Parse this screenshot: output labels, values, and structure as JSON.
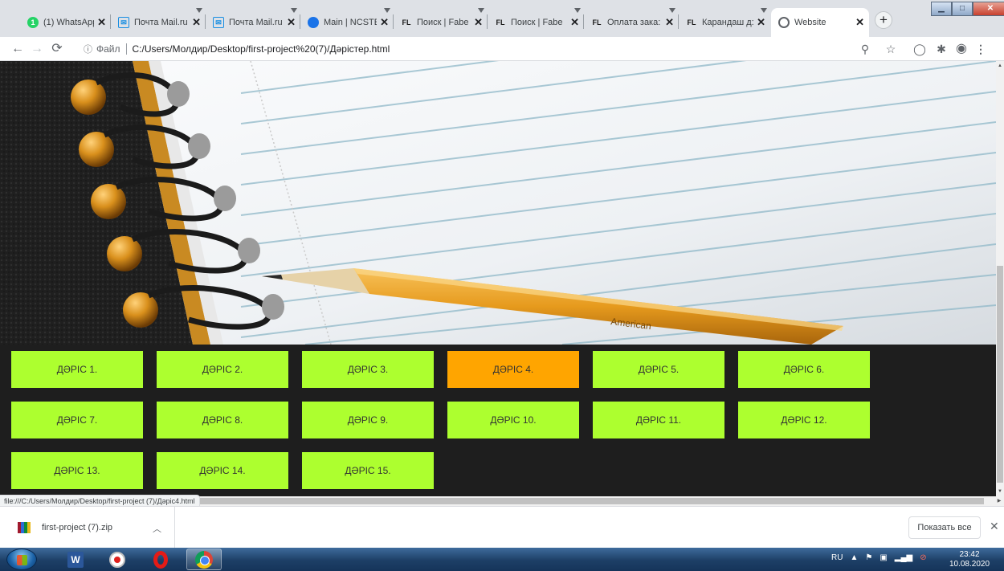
{
  "browser": {
    "tabs": [
      {
        "title": "(1) WhatsApp",
        "favicon": "whatsapp-icon",
        "active": false
      },
      {
        "title": "Почта Mail.ru",
        "favicon": "mail-icon",
        "active": false
      },
      {
        "title": "Почта Mail.ru",
        "favicon": "mail-icon",
        "active": false
      },
      {
        "title": "Main | NCSTE",
        "favicon": "ncste-icon",
        "active": false
      },
      {
        "title": "Поиск | Fabe",
        "favicon": "fl-icon",
        "active": false
      },
      {
        "title": "Поиск | Fabe",
        "favicon": "fl-icon",
        "active": false
      },
      {
        "title": "Оплата зака:",
        "favicon": "fl-icon",
        "active": false
      },
      {
        "title": "Карандаш д:",
        "favicon": "fl-icon",
        "active": false
      },
      {
        "title": "Website",
        "favicon": "globe-icon",
        "active": true
      }
    ],
    "fl_favicon_text": "FL",
    "whatsapp_badge": "1",
    "new_tab_symbol": "+",
    "close_symbol": "✕",
    "address": {
      "info_label": "Файл",
      "url": "C:/Users/Молдир/Desktop/first-project%20(7)/Дәрістер.html"
    },
    "status_url": "file:///C:/Users/Молдир/Desktop/first-project (7)/Дәріс4.html"
  },
  "page": {
    "hero_pencil_text": "American",
    "lessons": [
      {
        "label": "ДӘРІС 1.",
        "active": false
      },
      {
        "label": "ДӘРІС 2.",
        "active": false
      },
      {
        "label": "ДӘРІС 3.",
        "active": false
      },
      {
        "label": "ДӘРІС 4.",
        "active": true
      },
      {
        "label": "ДӘРІС 5.",
        "active": false
      },
      {
        "label": "ДӘРІС 6.",
        "active": false
      },
      {
        "label": "ДӘРІС 7.",
        "active": false
      },
      {
        "label": "ДӘРІС 8.",
        "active": false
      },
      {
        "label": "ДӘРІС 9.",
        "active": false
      },
      {
        "label": "ДӘРІС 10.",
        "active": false
      },
      {
        "label": "ДӘРІС 11.",
        "active": false
      },
      {
        "label": "ДӘРІС 12.",
        "active": false
      },
      {
        "label": "ДӘРІС 13.",
        "active": false
      },
      {
        "label": "ДӘРІС 14.",
        "active": false
      },
      {
        "label": "ДӘРІС 15.",
        "active": false
      }
    ],
    "colors": {
      "lesson_bg": "#adff2f",
      "lesson_active_bg": "#ffa500",
      "page_bg": "#1e1e1e"
    }
  },
  "downloads": {
    "file_name": "first-project (7).zip",
    "show_all_label": "Показать все",
    "close_symbol": "✕"
  },
  "taskbar": {
    "language": "RU",
    "time": "23:42",
    "date": "10.08.2020",
    "word_letter": "W"
  }
}
